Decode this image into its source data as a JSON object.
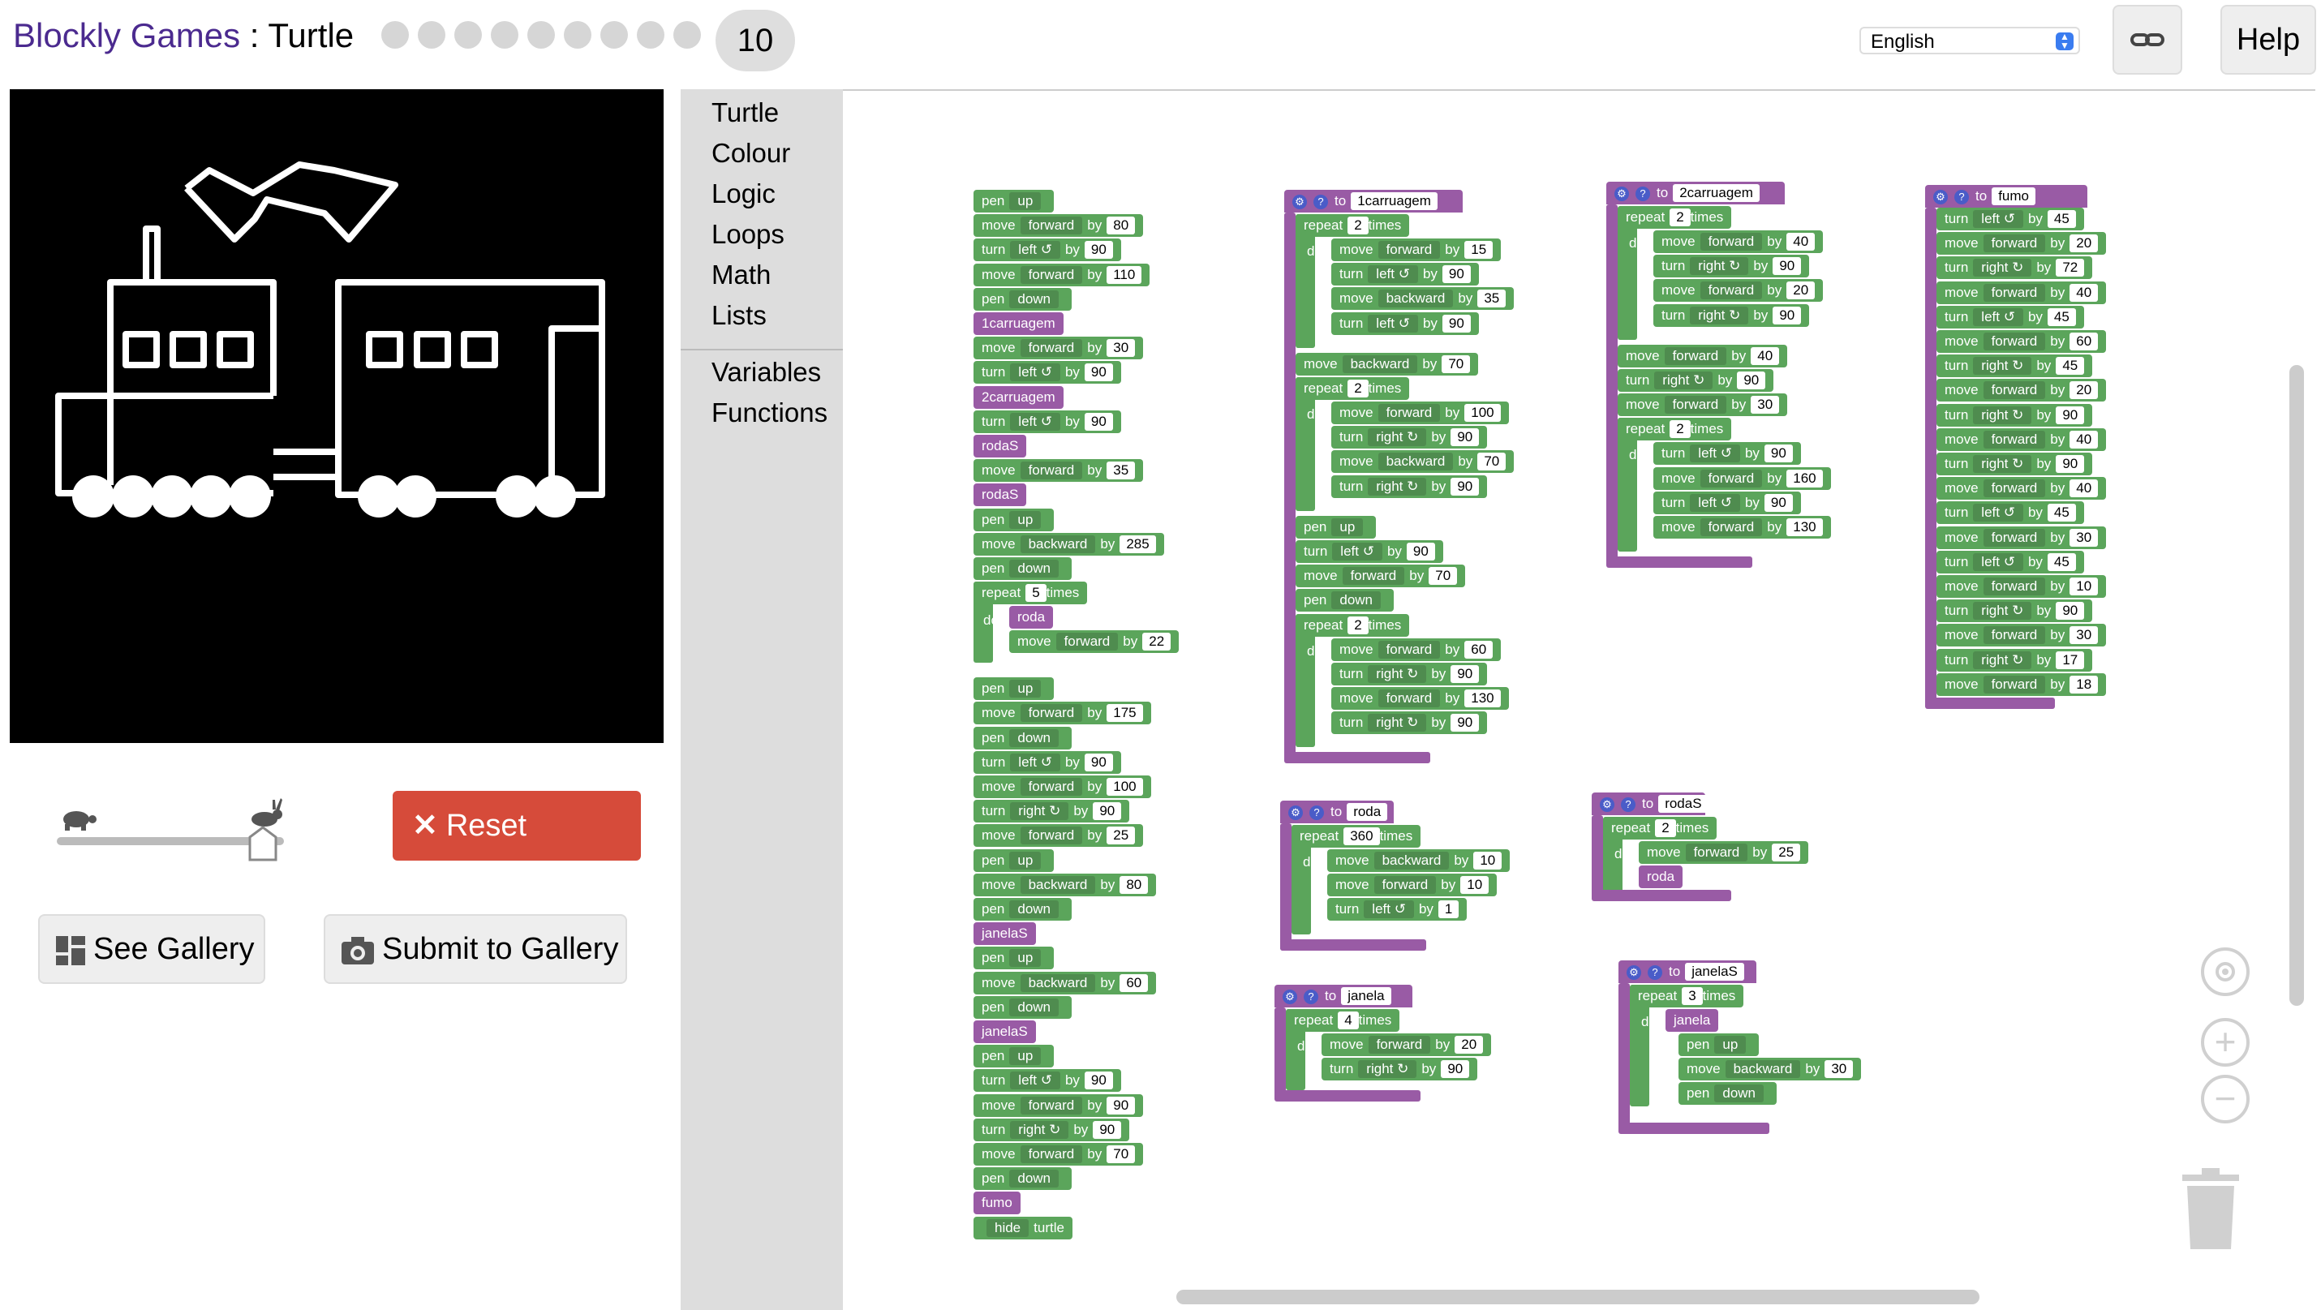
{
  "header": {
    "brand": "Blockly Games",
    "separator": " : ",
    "game": "Turtle",
    "level_dots": 9,
    "current_level": "10",
    "language": "English",
    "help_label": "Help"
  },
  "controls": {
    "reset_label": "Reset",
    "see_gallery_label": "See Gallery",
    "submit_gallery_label": "Submit to Gallery",
    "speed": 1.0
  },
  "toolbox": {
    "categories": [
      "Turtle",
      "Colour",
      "Logic",
      "Loops",
      "Math",
      "Lists"
    ],
    "categories2": [
      "Variables",
      "Functions"
    ]
  },
  "program": {
    "main": [
      {
        "c": "g",
        "t": "pen",
        "d": "up"
      },
      {
        "c": "g",
        "t": "move",
        "d": "forward",
        "k": "by",
        "v": "80"
      },
      {
        "c": "g",
        "t": "turn",
        "d": "left ↺",
        "k": "by",
        "v": "90"
      },
      {
        "c": "g",
        "t": "move",
        "d": "forward",
        "k": "by",
        "v": "110"
      },
      {
        "c": "g",
        "t": "pen",
        "d": "down"
      },
      {
        "c": "p",
        "t": "1carruagem"
      },
      {
        "c": "g",
        "t": "move",
        "d": "forward",
        "k": "by",
        "v": "30"
      },
      {
        "c": "g",
        "t": "turn",
        "d": "left ↺",
        "k": "by",
        "v": "90"
      },
      {
        "c": "p",
        "t": "2carruagem"
      },
      {
        "c": "g",
        "t": "turn",
        "d": "left ↺",
        "k": "by",
        "v": "90"
      },
      {
        "c": "p",
        "t": "rodaS"
      },
      {
        "c": "g",
        "t": "move",
        "d": "forward",
        "k": "by",
        "v": "35"
      },
      {
        "c": "p",
        "t": "rodaS"
      },
      {
        "c": "g",
        "t": "pen",
        "d": "up"
      },
      {
        "c": "g",
        "t": "move",
        "d": "backward",
        "k": "by",
        "v": "285"
      },
      {
        "c": "g",
        "t": "pen",
        "d": "down"
      }
    ],
    "repeat_main": {
      "label": "repeat",
      "count": "5",
      "times": "times",
      "do": "do",
      "call": "roda",
      "move": "move",
      "dir": "forward",
      "by": "by",
      "val": "22"
    },
    "main2": [
      {
        "c": "g",
        "t": "pen",
        "d": "up"
      },
      {
        "c": "g",
        "t": "move",
        "d": "forward",
        "k": "by",
        "v": "175"
      },
      {
        "c": "g",
        "t": "pen",
        "d": "down"
      },
      {
        "c": "g",
        "t": "turn",
        "d": "left ↺",
        "k": "by",
        "v": "90"
      },
      {
        "c": "g",
        "t": "move",
        "d": "forward",
        "k": "by",
        "v": "100"
      },
      {
        "c": "g",
        "t": "turn",
        "d": "right ↻",
        "k": "by",
        "v": "90"
      },
      {
        "c": "g",
        "t": "move",
        "d": "forward",
        "k": "by",
        "v": "25"
      },
      {
        "c": "g",
        "t": "pen",
        "d": "up"
      },
      {
        "c": "g",
        "t": "move",
        "d": "backward",
        "k": "by",
        "v": "80"
      },
      {
        "c": "g",
        "t": "pen",
        "d": "down"
      },
      {
        "c": "p",
        "t": "janelaS"
      },
      {
        "c": "g",
        "t": "pen",
        "d": "up"
      },
      {
        "c": "g",
        "t": "move",
        "d": "backward",
        "k": "by",
        "v": "60"
      },
      {
        "c": "g",
        "t": "pen",
        "d": "down"
      },
      {
        "c": "p",
        "t": "janelaS"
      },
      {
        "c": "g",
        "t": "pen",
        "d": "up"
      },
      {
        "c": "g",
        "t": "turn",
        "d": "left ↺",
        "k": "by",
        "v": "90"
      },
      {
        "c": "g",
        "t": "move",
        "d": "forward",
        "k": "by",
        "v": "90"
      },
      {
        "c": "g",
        "t": "turn",
        "d": "right ↻",
        "k": "by",
        "v": "90"
      },
      {
        "c": "g",
        "t": "move",
        "d": "forward",
        "k": "by",
        "v": "70"
      },
      {
        "c": "g",
        "t": "pen",
        "d": "down"
      },
      {
        "c": "p",
        "t": "fumo"
      },
      {
        "c": "g",
        "t": "hide",
        "d": "hide",
        "k": "turtle"
      }
    ],
    "fn_1carruagem": {
      "to": "to",
      "name": "1carruagem"
    },
    "fn_2carruagem": {
      "to": "to",
      "name": "2carruagem"
    },
    "fn_fumo": {
      "to": "to",
      "name": "fumo"
    },
    "fn_roda": {
      "to": "to",
      "name": "roda"
    },
    "fn_rodaS": {
      "to": "to",
      "name": "rodaS"
    },
    "fn_janela": {
      "to": "to",
      "name": "janela"
    },
    "fn_janelaS": {
      "to": "to",
      "name": "janelaS"
    },
    "c1": [
      {
        "r": "2",
        "body": [
          [
            "move",
            "forward",
            "15"
          ],
          [
            "turn",
            "left ↺",
            "90"
          ],
          [
            "move",
            "backward",
            "35"
          ],
          [
            "turn",
            "left ↺",
            "90"
          ]
        ]
      },
      {
        "line": [
          "move",
          "backward",
          "70"
        ]
      },
      {
        "r": "2",
        "body": [
          [
            "move",
            "forward",
            "100"
          ],
          [
            "turn",
            "right ↻",
            "90"
          ],
          [
            "move",
            "backward",
            "70"
          ],
          [
            "turn",
            "right ↻",
            "90"
          ]
        ]
      },
      {
        "pen": "up"
      },
      {
        "line": [
          "turn",
          "left ↺",
          "90"
        ]
      },
      {
        "line": [
          "move",
          "forward",
          "70"
        ]
      },
      {
        "pen": "down"
      },
      {
        "r": "2",
        "body": [
          [
            "move",
            "forward",
            "60"
          ],
          [
            "turn",
            "right ↻",
            "90"
          ],
          [
            "move",
            "forward",
            "130"
          ],
          [
            "turn",
            "right ↻",
            "90"
          ]
        ]
      }
    ],
    "c2": [
      {
        "r": "2",
        "body": [
          [
            "move",
            "forward",
            "40"
          ],
          [
            "turn",
            "right ↻",
            "90"
          ],
          [
            "move",
            "forward",
            "20"
          ],
          [
            "turn",
            "right ↻",
            "90"
          ]
        ]
      },
      {
        "line": [
          "move",
          "forward",
          "40"
        ]
      },
      {
        "line": [
          "turn",
          "right ↻",
          "90"
        ]
      },
      {
        "line": [
          "move",
          "forward",
          "30"
        ]
      },
      {
        "r": "2",
        "body": [
          [
            "turn",
            "left ↺",
            "90"
          ],
          [
            "move",
            "forward",
            "160"
          ],
          [
            "turn",
            "left ↺",
            "90"
          ],
          [
            "move",
            "forward",
            "130"
          ]
        ]
      }
    ],
    "fumo": [
      [
        "turn",
        "left ↺",
        "45"
      ],
      [
        "move",
        "forward",
        "20"
      ],
      [
        "turn",
        "right ↻",
        "72"
      ],
      [
        "move",
        "forward",
        "40"
      ],
      [
        "turn",
        "left ↺",
        "45"
      ],
      [
        "move",
        "forward",
        "60"
      ],
      [
        "turn",
        "right ↻",
        "45"
      ],
      [
        "move",
        "forward",
        "20"
      ],
      [
        "turn",
        "right ↻",
        "90"
      ],
      [
        "move",
        "forward",
        "40"
      ],
      [
        "turn",
        "right ↻",
        "90"
      ],
      [
        "move",
        "forward",
        "40"
      ],
      [
        "turn",
        "left ↺",
        "45"
      ],
      [
        "move",
        "forward",
        "30"
      ],
      [
        "turn",
        "left ↺",
        "45"
      ],
      [
        "move",
        "forward",
        "10"
      ],
      [
        "turn",
        "right ↻",
        "90"
      ],
      [
        "move",
        "forward",
        "30"
      ],
      [
        "turn",
        "right ↻",
        "17"
      ],
      [
        "move",
        "forward",
        "18"
      ]
    ],
    "roda": {
      "r": "360",
      "body": [
        [
          "move",
          "backward",
          "10"
        ],
        [
          "move",
          "forward",
          "10"
        ],
        [
          "turn",
          "left ↺",
          "1"
        ]
      ]
    },
    "rodaS": {
      "r": "2",
      "body": [
        [
          "move",
          "forward",
          "25"
        ]
      ],
      "call": "roda"
    },
    "janela": {
      "r": "4",
      "body": [
        [
          "move",
          "forward",
          "20"
        ],
        [
          "turn",
          "right ↻",
          "90"
        ]
      ]
    },
    "janelaS": {
      "r": "3",
      "call": "janela",
      "pen1": "up",
      "mv": [
        "move",
        "backward",
        "30"
      ],
      "pen2": "down"
    },
    "words": {
      "repeat": "repeat",
      "times": "times",
      "do": "do",
      "by": "by",
      "pen": "pen"
    }
  }
}
